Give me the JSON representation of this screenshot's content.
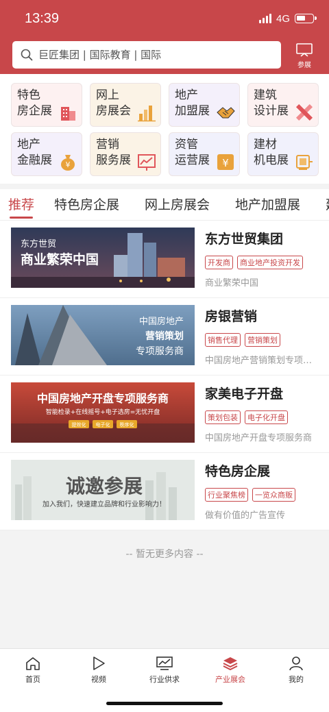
{
  "status": {
    "time": "13:39",
    "network": "4G"
  },
  "search": {
    "placeholder": "巨匠集团 | 国际教育 | 国际",
    "icon": "search-icon"
  },
  "join": {
    "label": "参展",
    "icon": "exhibit-board-icon"
  },
  "categories": [
    {
      "line1": "特色",
      "line2": "房企展",
      "icon": "building-icon",
      "color": "#fdf1f1",
      "accent": "#e0555a"
    },
    {
      "line1": "网上",
      "line2": "房展会",
      "icon": "bar-chart-icon",
      "color": "#fbf3e6",
      "accent": "#e9a23b"
    },
    {
      "line1": "地产",
      "line2": "加盟展",
      "icon": "handshake-icon",
      "color": "#f4f0fb",
      "accent": "#e9a23b"
    },
    {
      "line1": "建筑",
      "line2": "设计展",
      "icon": "pencil-ruler-icon",
      "color": "#fdf1f1",
      "accent": "#e0555a"
    },
    {
      "line1": "地产",
      "line2": "金融展",
      "icon": "money-bag-icon",
      "color": "#f4f0fb",
      "accent": "#e9a23b"
    },
    {
      "line1": "营销",
      "line2": "服务展",
      "icon": "trend-board-icon",
      "color": "#fbf3e6",
      "accent": "#e0555a"
    },
    {
      "line1": "资管",
      "line2": "运营展",
      "icon": "yen-box-icon",
      "color": "#f1f1fc",
      "accent": "#e9a23b"
    },
    {
      "line1": "建材",
      "line2": "机电展",
      "icon": "machine-icon",
      "color": "#f1f1fc",
      "accent": "#e9a23b"
    }
  ],
  "tabs": [
    "推荐",
    "特色房企展",
    "网上房展会",
    "地产加盟展",
    "建"
  ],
  "active_tab": "推荐",
  "items": [
    {
      "name": "东方世贸集团",
      "tags": [
        "开发商",
        "商业地产投资开发"
      ],
      "desc": "商业繁荣中国",
      "banner": {
        "line1": "东方世贸",
        "line2": "商业繁荣中国"
      }
    },
    {
      "name": "房银营销",
      "tags": [
        "销售代理",
        "营销策划"
      ],
      "desc": "中国房地产营销策划专项服务商",
      "banner": {
        "line1": "中国房地产",
        "line2": "营销策划",
        "line3": "专项服务商"
      }
    },
    {
      "name": "家美电子开盘",
      "tags": [
        "策划包装",
        "电子化开盘"
      ],
      "desc": "中国房地产开盘专项服务商",
      "banner": {
        "line1": "中国房地产开盘专项服务商",
        "line2": "智能检录+在线摇号+电子选房=无忧开盘",
        "b1": "提效化",
        "b2": "电子化",
        "b3": "秩序化"
      }
    },
    {
      "name": "特色房企展",
      "tags": [
        "行业聚焦榜",
        "一览众商贩"
      ],
      "desc": "做有价值的广告宣传",
      "banner": {
        "line1": "诚邀参展",
        "line2": "加入我们，快速建立品牌和行业影响力！"
      }
    }
  ],
  "no_more": "-- 暂无更多内容 --",
  "tabbar": [
    {
      "label": "首页",
      "icon": "home-icon"
    },
    {
      "label": "视频",
      "icon": "play-icon"
    },
    {
      "label": "行业供求",
      "icon": "chart-screen-icon"
    },
    {
      "label": "产业展会",
      "icon": "layers-icon"
    },
    {
      "label": "我的",
      "icon": "user-icon"
    }
  ],
  "active_nav": "产业展会",
  "theme": {
    "primary": "#c8474a"
  }
}
